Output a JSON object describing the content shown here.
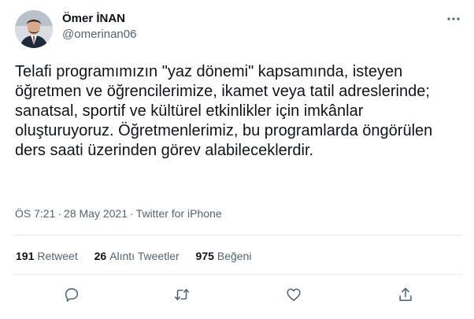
{
  "author": {
    "name": "Ömer İNAN",
    "handle": "@omerinan06"
  },
  "tweet": {
    "text": "Telafi programımızın \"yaz dönemi\" kapsamında, isteyen öğretmen ve öğrencilerimize, ikamet veya tatil adreslerinde; sanatsal, sportif ve kültürel etkinlikler için imkânlar oluşturuyoruz. Öğretmenlerimiz, bu programlarda öngörülen ders saati üzerinden görev alabileceklerdir.",
    "time": "ÖS 7:21",
    "date": "28 May 2021",
    "source": "Twitter for iPhone",
    "separator": "·"
  },
  "stats": {
    "retweets": {
      "count": "191",
      "label": "Retweet"
    },
    "quotes": {
      "count": "26",
      "label": "Alıntı Tweetler"
    },
    "likes": {
      "count": "975",
      "label": "Beğeni"
    }
  },
  "icons": {
    "more": "more-dots-icon",
    "reply": "reply-icon",
    "retweet": "retweet-icon",
    "like": "heart-icon",
    "share": "share-icon"
  },
  "colors": {
    "text": "#0f1419",
    "secondary": "#536471",
    "divider": "#e6ecf0"
  }
}
